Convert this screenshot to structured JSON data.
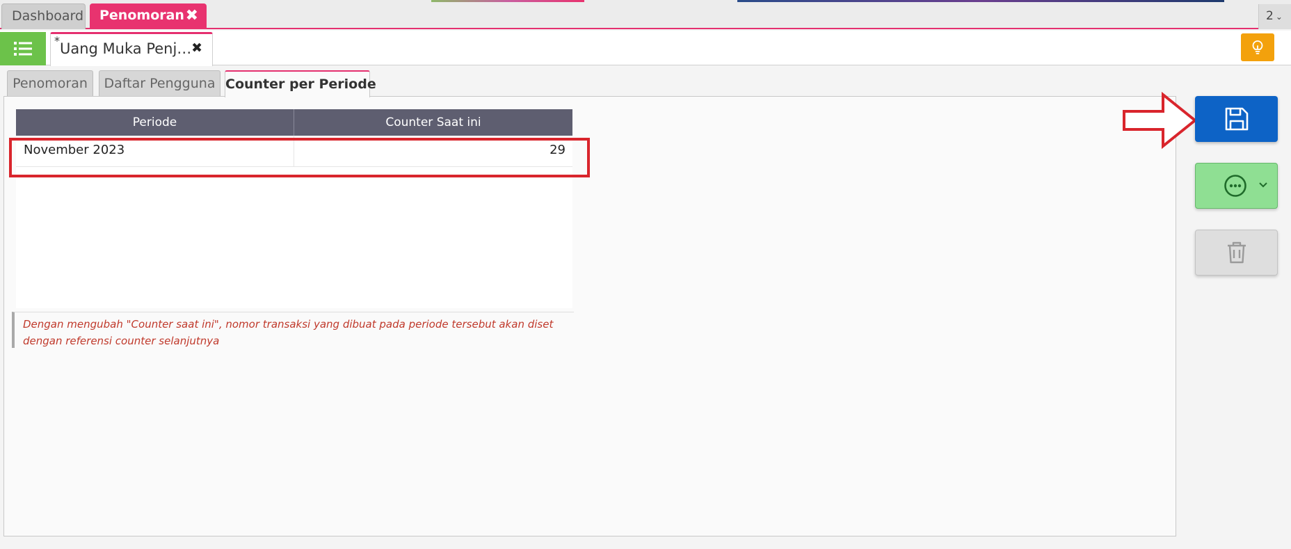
{
  "app_tabs": [
    {
      "label": "Dashboard"
    },
    {
      "label": "Penomoran",
      "close_glyph": "✖"
    }
  ],
  "tab_count": {
    "value": "2"
  },
  "doc_tab": {
    "modified_marker": "*",
    "label": "Uang Muka Penj…",
    "close_glyph": "✖"
  },
  "sub_tabs": [
    {
      "label": "Penomoran"
    },
    {
      "label": "Daftar Pengguna"
    },
    {
      "label": "Counter per Periode"
    }
  ],
  "grid": {
    "columns": [
      "Periode",
      "Counter Saat ini"
    ],
    "rows": [
      {
        "periode": "November 2023",
        "counter": "29"
      }
    ]
  },
  "note": "Dengan mengubah \"Counter saat ini\", nomor transaksi yang dibuat pada periode tersebut akan diset dengan referensi counter selanjutnya",
  "icons": {
    "menu": "list-icon",
    "tip": "lightbulb-icon",
    "save": "floppy-disk-icon",
    "more": "ellipsis-circle-icon",
    "delete": "trash-icon"
  },
  "colors": {
    "accent_pink": "#e8336f",
    "menu_green": "#6cc24a",
    "tip_orange": "#f3a10c",
    "save_blue": "#0d63c6",
    "more_green": "#8fdf93",
    "grid_header": "#5e5e70",
    "highlight_red": "#d9252c",
    "note_red": "#c0392b"
  }
}
